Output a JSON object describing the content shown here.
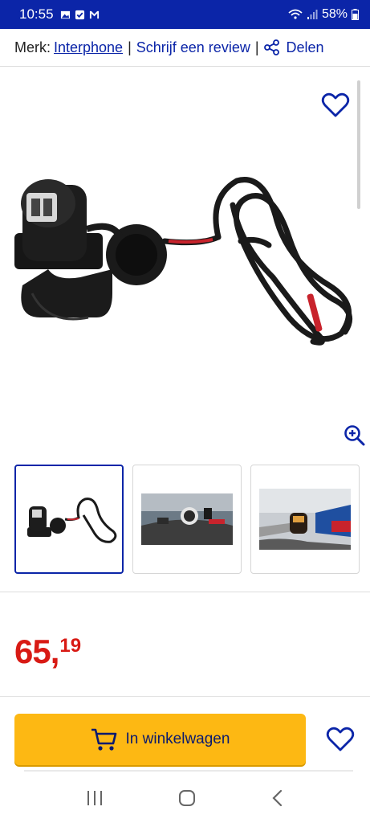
{
  "status_bar": {
    "time": "10:55",
    "battery": "58%",
    "icons": [
      "gallery-icon",
      "check-icon",
      "mail-icon",
      "wifi-icon",
      "signal-icon",
      "battery-icon"
    ]
  },
  "meta": {
    "brand_label": "Merk:",
    "brand_name": "Interphone",
    "review_label": "Schrijf een review",
    "share_label": "Delen"
  },
  "gallery": {
    "thumbnails": [
      "usb-charger-product",
      "motorcycle-handlebar-photo",
      "mounted-charger-photo"
    ],
    "active_index": 0
  },
  "price": {
    "whole": "65",
    "separator": ",",
    "cents": "19"
  },
  "actions": {
    "cart_label": "In winkelwagen"
  },
  "colors": {
    "brand_blue": "#0b25a8",
    "price_red": "#d81a14",
    "cart_yellow": "#fdb813"
  }
}
